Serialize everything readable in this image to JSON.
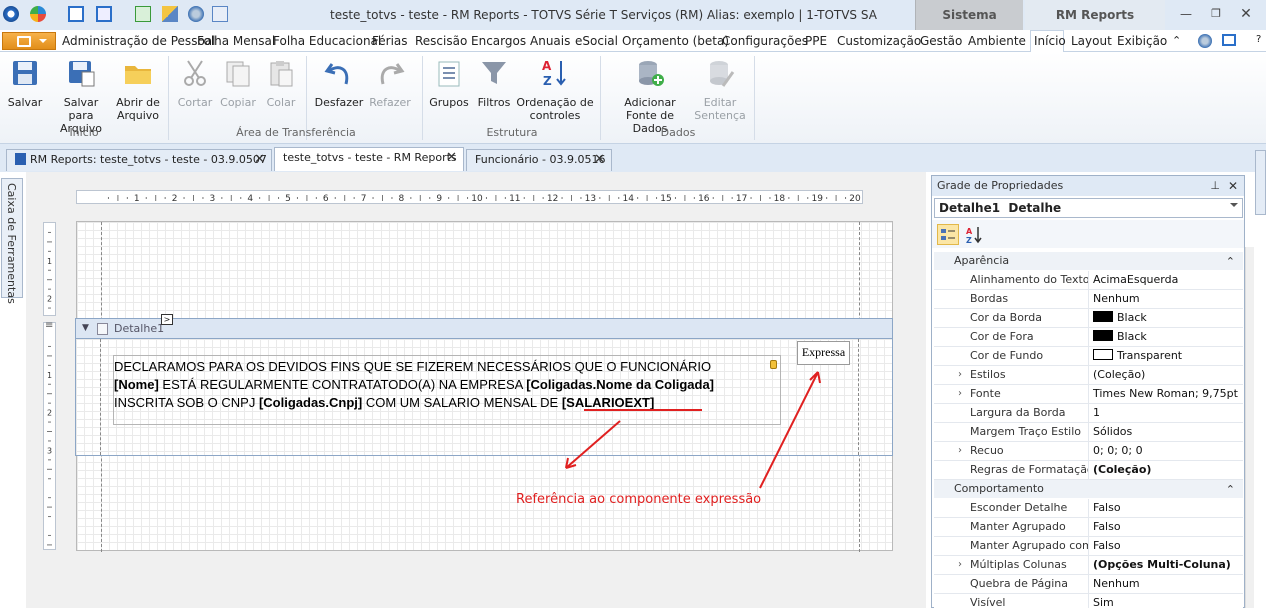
{
  "window": {
    "title": "teste_totvs - teste - RM Reports - TOTVS Série T Serviços (RM) Alias: exemplo | 1-TOTVS SA",
    "context_tabs": [
      "Sistema",
      "RM Reports"
    ]
  },
  "menu": {
    "items": [
      "Administração de Pessoal",
      "Folha Mensal",
      "Folha Educacional",
      "Férias",
      "Rescisão",
      "Encargos",
      "Anuais",
      "eSocial",
      "Orçamento (beta)",
      "Configurações",
      "PPE",
      "Customização",
      "Gestão",
      "Ambiente",
      "Início",
      "Layout",
      "Exibição"
    ]
  },
  "ribbon": {
    "inicio": {
      "label": "Início",
      "buttons": [
        [
          "Salvar",
          ""
        ],
        [
          "Salvar para",
          "Arquivo"
        ],
        [
          "Abrir de",
          "Arquivo"
        ]
      ]
    },
    "clipboard": {
      "label": "Área de Transferência",
      "buttons": [
        [
          "Cortar",
          ""
        ],
        [
          "Copiar",
          ""
        ],
        [
          "Colar",
          ""
        ],
        [
          "Desfazer",
          ""
        ],
        [
          "Refazer",
          ""
        ]
      ]
    },
    "estrutura": {
      "label": "Estrutura",
      "buttons": [
        [
          "Grupos",
          ""
        ],
        [
          "Filtros",
          ""
        ],
        [
          "Ordenação de",
          "controles"
        ]
      ]
    },
    "dados": {
      "label": "Dados",
      "buttons": [
        [
          "Adicionar",
          "Fonte de Dados"
        ],
        [
          "Editar",
          "Sentença"
        ]
      ]
    }
  },
  "doc_tabs": [
    "RM Reports: teste_totvs - teste - 03.9.0507",
    "teste_totvs - teste - RM Reports",
    "Funcionário - 03.9.0516"
  ],
  "toolbox_label": "Caixa de Ferramentas",
  "ruler": {
    "h": [
      "1",
      "2",
      "3",
      "4",
      "5",
      "6",
      "7",
      "8",
      "9",
      "10",
      "11",
      "12",
      "13",
      "14",
      "15",
      "16",
      "17",
      "18",
      "19",
      "20"
    ],
    "v_top": [
      "1",
      "2"
    ],
    "v_band": [
      "1",
      "2",
      "3"
    ]
  },
  "band": {
    "name": "Detalhe1",
    "text_lines": [
      {
        "parts": [
          {
            "t": "DECLARAMOS PARA OS DEVIDOS FINS QUE SE FIZEREM NECESSÁRIOS QUE O FUNCIONÁRIO",
            "b": false
          }
        ]
      },
      {
        "parts": [
          {
            "t": "[Nome]",
            "b": true
          },
          {
            "t": " ESTÁ REGULARMENTE CONTRATATODO(A) NA EMPRESA ",
            "b": false
          },
          {
            "t": "[Coligadas.Nome da Coligada]",
            "b": true
          }
        ]
      },
      {
        "parts": [
          {
            "t": "INSCRITA SOB O CNPJ ",
            "b": false
          },
          {
            "t": "[Coligadas.Cnpj]",
            "b": true
          },
          {
            "t": " COM UM SALARIO MENSAL DE ",
            "b": false
          },
          {
            "t": "[SALARIOEXT]",
            "b": true
          }
        ]
      }
    ],
    "expression_box": "Expressa"
  },
  "annotation": "Referência ao componente expressão",
  "properties": {
    "title": "Grade de Propriedades",
    "selected": "Detalhe1  Detalhe",
    "categories": [
      {
        "name": "Aparência",
        "rows": [
          {
            "k": "Alinhamento do Texto",
            "v": "AcimaEsquerda"
          },
          {
            "k": "Bordas",
            "v": "Nenhum"
          },
          {
            "k": "Cor da Borda",
            "v": "Black",
            "swatch": "#000000"
          },
          {
            "k": "Cor de Fora",
            "v": "Black",
            "swatch": "#000000"
          },
          {
            "k": "Cor de Fundo",
            "v": "Transparent",
            "swatch": "#ffffff"
          },
          {
            "k": "Estilos",
            "v": "(Coleção)",
            "expand": true
          },
          {
            "k": "Fonte",
            "v": "Times New Roman; 9,75pt",
            "expand": true
          },
          {
            "k": "Largura da Borda",
            "v": "1"
          },
          {
            "k": "Margem Traço Estilo",
            "v": "Sólidos"
          },
          {
            "k": "Recuo",
            "v": "0; 0; 0; 0",
            "expand": true
          },
          {
            "k": "Regras de Formatação",
            "v": "(Coleção)",
            "bold": true
          }
        ]
      },
      {
        "name": "Comportamento",
        "rows": [
          {
            "k": "Esconder Detalhe",
            "v": "Falso"
          },
          {
            "k": "Manter Agrupado",
            "v": "Falso"
          },
          {
            "k": "Manter Agrupado com a",
            "v": "Falso"
          },
          {
            "k": "Múltiplas Colunas",
            "v": "(Opções Multi-Coluna)",
            "expand": true,
            "bold": true
          },
          {
            "k": "Quebra de Página",
            "v": "Nenhum"
          },
          {
            "k": "Visível",
            "v": "Sim"
          }
        ]
      }
    ]
  },
  "colors": {
    "accent": "#e28e19",
    "annotation": "#e02020",
    "band": "#dce6f3"
  }
}
